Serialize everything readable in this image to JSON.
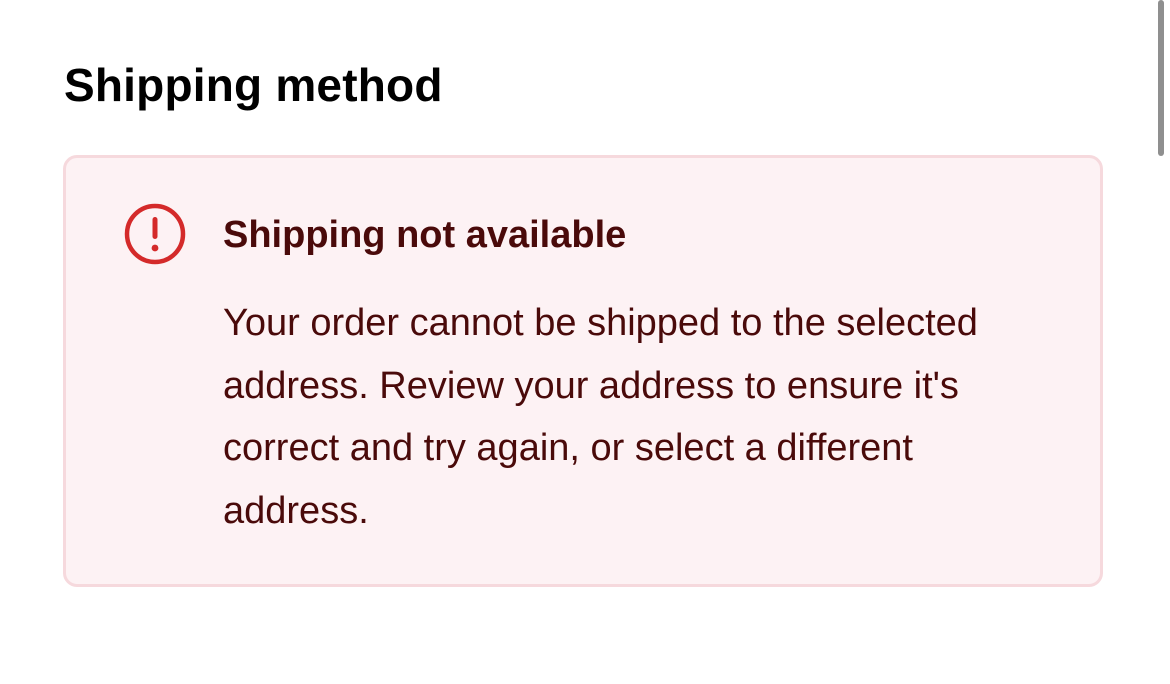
{
  "section": {
    "title": "Shipping method"
  },
  "alert": {
    "icon": "exclamation-circle-icon",
    "title": "Shipping not available",
    "message": "Your order cannot be shipped to the selected address. Review your address to ensure it's correct and try again, or select a different address.",
    "colors": {
      "background": "#fdf2f4",
      "border": "#f6d9dd",
      "icon": "#d42a2a",
      "text": "#4a0a0a"
    }
  }
}
